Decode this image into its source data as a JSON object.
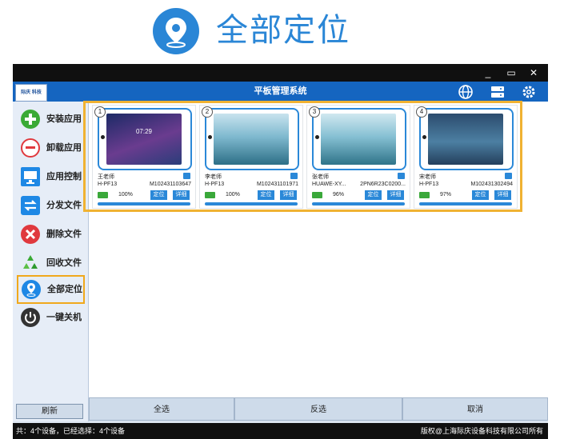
{
  "promo": {
    "title": "全部定位",
    "icon": "location-pin-icon"
  },
  "window": {
    "controls": [
      "_",
      "▭",
      "✕"
    ],
    "logo_text": "际庆 科技",
    "app_title": "平板管理系统",
    "toolbar_icons": [
      "globe-icon",
      "server-icon",
      "gear-icon"
    ]
  },
  "sidebar": {
    "items": [
      {
        "label": "安装应用",
        "icon": "plus-icon",
        "color": "#3aaa35"
      },
      {
        "label": "卸载应用",
        "icon": "minus-icon",
        "color": "#e0393e"
      },
      {
        "label": "应用控制",
        "icon": "monitor-icon",
        "color": "#1e88e5"
      },
      {
        "label": "分发文件",
        "icon": "swap-arrows-icon",
        "color": "#1e88e5"
      },
      {
        "label": "删除文件",
        "icon": "close-icon",
        "color": "#e0393e"
      },
      {
        "label": "回收文件",
        "icon": "recycle-icon",
        "color": "#3aaa35"
      },
      {
        "label": "全部定位",
        "icon": "location-pin-icon",
        "color": "#1e88e5"
      },
      {
        "label": "一键关机",
        "icon": "power-icon",
        "color": "#333333"
      }
    ],
    "active_index": 6,
    "refresh_label": "刷新"
  },
  "tablets": [
    {
      "num": "1",
      "teacher": "王老师",
      "model": "H-PF13",
      "serial": "M102431103647",
      "battery": "100%",
      "time": "07:29",
      "screen": "dark",
      "locate_label": "定位",
      "detail_label": "详细"
    },
    {
      "num": "2",
      "teacher": "李老师",
      "model": "H-PF13",
      "serial": "M102431101971",
      "battery": "100%",
      "time": "",
      "screen": "ice",
      "locate_label": "定位",
      "detail_label": "详细"
    },
    {
      "num": "3",
      "teacher": "张老师",
      "model": "HUAWE-XY...",
      "serial": "2PN6R23C0200...",
      "battery": "96%",
      "time": "",
      "screen": "ice",
      "locate_label": "定位",
      "detail_label": "详细"
    },
    {
      "num": "4",
      "teacher": "宋老师",
      "model": "H-PF13",
      "serial": "M102431302494",
      "battery": "97%",
      "time": "",
      "screen": "lock",
      "locate_label": "定位",
      "detail_label": "详细"
    }
  ],
  "bottom_buttons": {
    "select_all": "全选",
    "invert": "反选",
    "cancel": "取消"
  },
  "status": {
    "left": "共：4个设备，已经选择：4个设备",
    "right": "版权@上海际庆设备科技有限公司所有"
  }
}
